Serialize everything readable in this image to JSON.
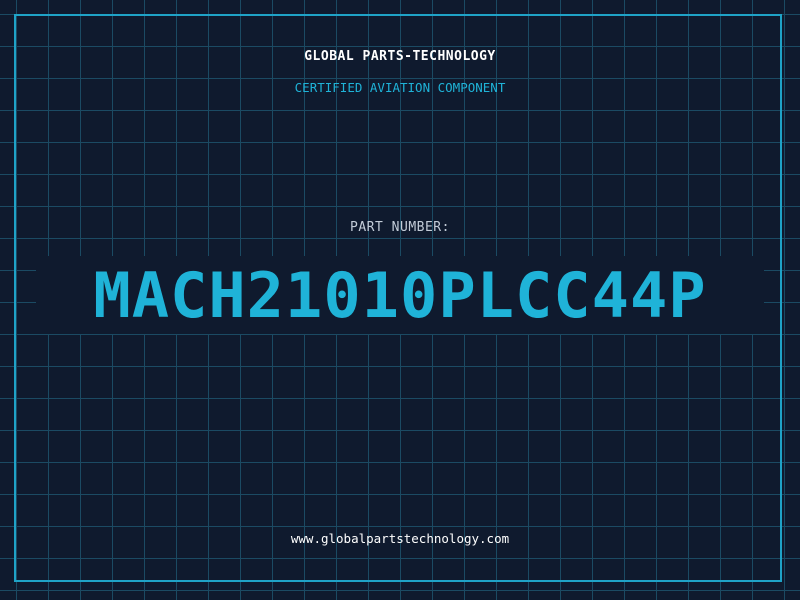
{
  "header": {
    "brand": "GLOBAL PARTS-TECHNOLOGY",
    "tagline": "CERTIFIED AVIATION COMPONENT"
  },
  "part": {
    "label": "PART NUMBER:",
    "number": "MACH21010PLCC44P"
  },
  "footer": {
    "url": "www.globalpartstechnology.com"
  },
  "colors": {
    "background": "#0f1a2e",
    "grid": "#1b4a63",
    "accent": "#1fb3d8",
    "border": "#1fa3c7",
    "label": "#c3ccd8",
    "text": "#ffffff"
  }
}
